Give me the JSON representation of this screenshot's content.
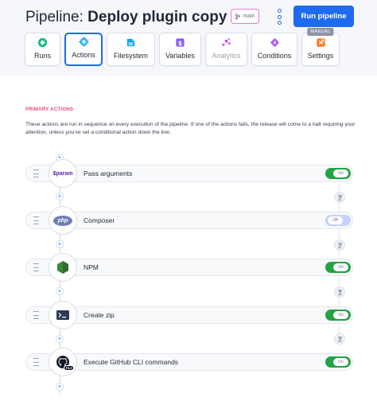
{
  "header": {
    "title_prefix": "Pipeline:",
    "title_name": "Deploy plugin copy",
    "branch": "main",
    "run_button": "Run pipeline"
  },
  "tabs": [
    {
      "label": "Runs",
      "icon": "runs-icon",
      "color": "#10b981"
    },
    {
      "label": "Actions",
      "icon": "actions-icon",
      "color": "#0ea5e9",
      "active": true
    },
    {
      "label": "Filesystem",
      "icon": "filesystem-icon",
      "color": "#0ea5e9"
    },
    {
      "label": "Variables",
      "icon": "variables-icon",
      "color": "#8b5cf6"
    },
    {
      "label": "Analytics",
      "icon": "analytics-icon",
      "color": "#a855f7"
    },
    {
      "label": "Conditions",
      "icon": "conditions-icon",
      "color": "#a855f7"
    },
    {
      "label": "Settings",
      "icon": "settings-icon",
      "color": "#f97316",
      "badge": "MANUAL"
    }
  ],
  "section": {
    "label": "PRIMARY ACTIONS",
    "description": "These actions are run in sequence on every execution of the pipeline. If one of the actions fails, the release will come to a halt requiring your attention, unless you've set a conditional action down the line."
  },
  "actions": [
    {
      "label": "Pass arguments",
      "icon": "param-icon",
      "icon_text": "$param",
      "enabled": true,
      "toggle_text": "On"
    },
    {
      "label": "Composer",
      "icon": "php-icon",
      "icon_text": "php",
      "enabled": false,
      "toggle_text": "Off"
    },
    {
      "label": "NPM",
      "icon": "nodejs-icon",
      "icon_text": "",
      "enabled": true,
      "toggle_text": "On"
    },
    {
      "label": "Create zip",
      "icon": "terminal-icon",
      "icon_text": "",
      "enabled": true,
      "toggle_text": "On"
    },
    {
      "label": "Execute GitHub CLI commands",
      "icon": "github-cli-icon",
      "icon_text": "CLI",
      "enabled": true,
      "toggle_text": "On"
    }
  ],
  "colors": {
    "accent": "#1e6bf0",
    "toggle_on": "#22a344",
    "toggle_off": "#c7d2fe",
    "section_label": "#e0457b"
  }
}
